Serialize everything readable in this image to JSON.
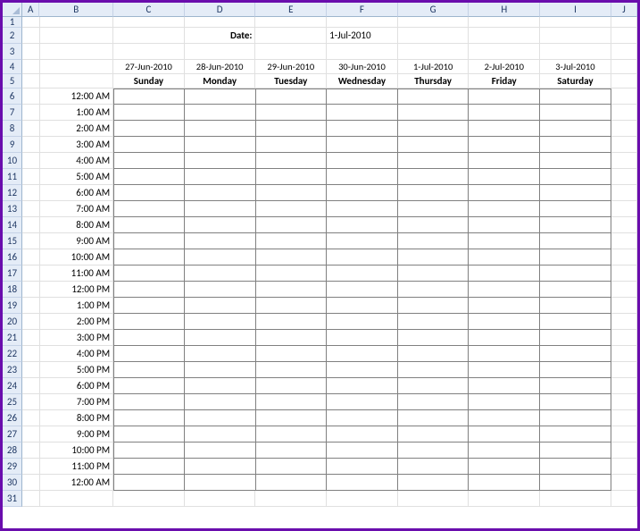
{
  "columns": [
    "A",
    "B",
    "C",
    "D",
    "E",
    "F",
    "G",
    "H",
    "I",
    "J"
  ],
  "rowNumbers": [
    "1",
    "2",
    "3",
    "4",
    "5",
    "6",
    "7",
    "8",
    "9",
    "10",
    "11",
    "12",
    "13",
    "14",
    "15",
    "16",
    "17",
    "18",
    "19",
    "20",
    "21",
    "22",
    "23",
    "24",
    "25",
    "26",
    "27",
    "28",
    "29",
    "30",
    "31"
  ],
  "dateLabel": "Date:",
  "dateValue": "1-Jul-2010",
  "days": [
    {
      "date": "27-Jun-2010",
      "name": "Sunday"
    },
    {
      "date": "28-Jun-2010",
      "name": "Monday"
    },
    {
      "date": "29-Jun-2010",
      "name": "Tuesday"
    },
    {
      "date": "30-Jun-2010",
      "name": "Wednesday"
    },
    {
      "date": "1-Jul-2010",
      "name": "Thursday"
    },
    {
      "date": "2-Jul-2010",
      "name": "Friday"
    },
    {
      "date": "3-Jul-2010",
      "name": "Saturday"
    }
  ],
  "times": [
    "12:00 AM",
    "1:00 AM",
    "2:00 AM",
    "3:00 AM",
    "4:00 AM",
    "5:00 AM",
    "6:00 AM",
    "7:00 AM",
    "8:00 AM",
    "9:00 AM",
    "10:00 AM",
    "11:00 AM",
    "12:00 PM",
    "1:00 PM",
    "2:00 PM",
    "3:00 PM",
    "4:00 PM",
    "5:00 PM",
    "6:00 PM",
    "7:00 PM",
    "8:00 PM",
    "9:00 PM",
    "10:00 PM",
    "11:00 PM",
    "12:00 AM"
  ]
}
